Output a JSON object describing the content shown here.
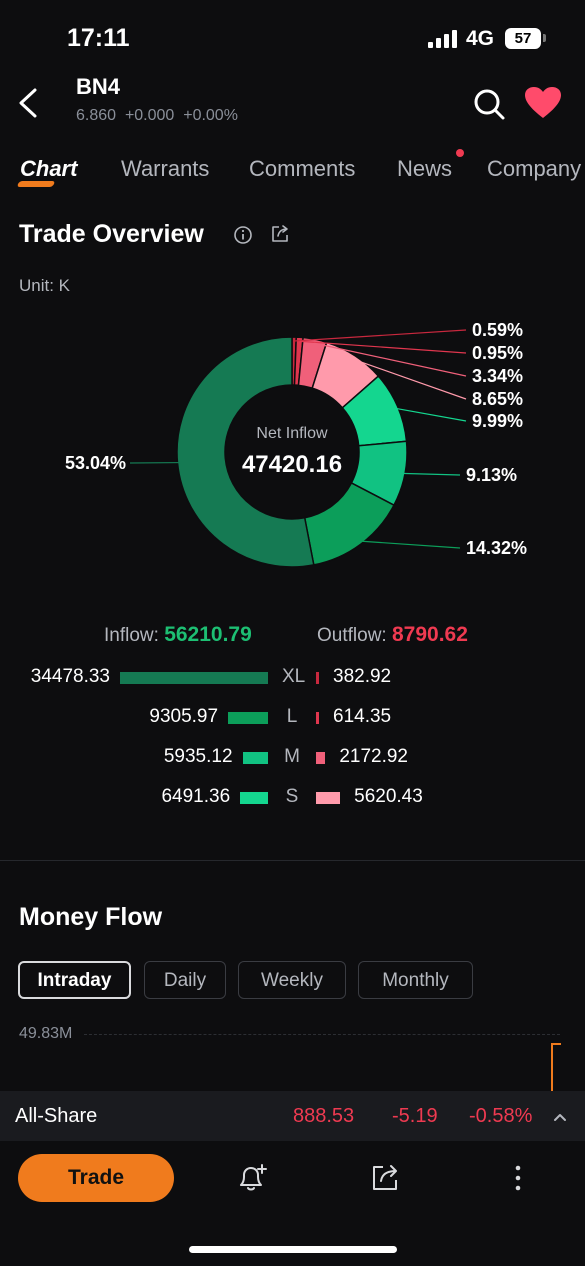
{
  "status_bar": {
    "time": "17:11",
    "network": "4G",
    "battery": "57"
  },
  "header": {
    "ticker": "BN4",
    "price": "6.860",
    "change": "+0.000",
    "change_pct": "+0.00%"
  },
  "tabs": [
    {
      "label": "Chart",
      "active": true
    },
    {
      "label": "Warrants"
    },
    {
      "label": "Comments"
    },
    {
      "label": "News",
      "has_dot": true
    },
    {
      "label": "Company"
    }
  ],
  "trade_overview": {
    "title": "Trade Overview",
    "unit": "Unit: K",
    "center_label": "Net Inflow",
    "center_value": "47420.16",
    "inflow_label": "Inflow:",
    "inflow_value": "56210.79",
    "outflow_label": "Outflow:",
    "outflow_value": "8790.62",
    "rows": [
      {
        "cat": "XL",
        "inflow": "34478.33",
        "outflow": "382.92",
        "inflow_num": 34478.33,
        "outflow_num": 382.92
      },
      {
        "cat": "L",
        "inflow": "9305.97",
        "outflow": "614.35",
        "inflow_num": 9305.97,
        "outflow_num": 614.35
      },
      {
        "cat": "M",
        "inflow": "5935.12",
        "outflow": "2172.92",
        "inflow_num": 5935.12,
        "outflow_num": 2172.92
      },
      {
        "cat": "S",
        "inflow": "6491.36",
        "outflow": "5620.43",
        "inflow_num": 6491.36,
        "outflow_num": 5620.43
      }
    ]
  },
  "chart_data": {
    "type": "pie",
    "slices": [
      {
        "label": "0.59%",
        "value": 0.59,
        "color": "#c8283e"
      },
      {
        "label": "0.95%",
        "value": 0.95,
        "color": "#e0364e"
      },
      {
        "label": "3.34%",
        "value": 3.34,
        "color": "#f0607a"
      },
      {
        "label": "8.65%",
        "value": 8.65,
        "color": "#ff9aab"
      },
      {
        "label": "9.99%",
        "value": 9.99,
        "color": "#14d68f"
      },
      {
        "label": "9.13%",
        "value": 9.13,
        "color": "#11c282"
      },
      {
        "label": "14.32%",
        "value": 14.32,
        "color": "#0c9e5a"
      },
      {
        "label": "53.04%",
        "value": 53.04,
        "color": "#157a53"
      }
    ]
  },
  "colors": {
    "accent": "#f07b1d",
    "inflow_xl": "#157a53",
    "inflow_l": "#0c9e5a",
    "inflow_m": "#11c282",
    "inflow_s": "#14d68f",
    "outflow_xl": "#c8283e",
    "outflow_l": "#e0364e",
    "outflow_m": "#f0607a",
    "outflow_s": "#ff9aab"
  },
  "money_flow": {
    "title": "Money Flow",
    "chips": [
      {
        "label": "Intraday",
        "active": true
      },
      {
        "label": "Daily"
      },
      {
        "label": "Weekly"
      },
      {
        "label": "Monthly"
      }
    ],
    "y_label": "49.83M"
  },
  "index_bar": {
    "name": "All-Share",
    "value": "888.53",
    "change": "-5.19",
    "change_pct": "-0.58%"
  },
  "bottom_bar": {
    "trade_label": "Trade"
  }
}
